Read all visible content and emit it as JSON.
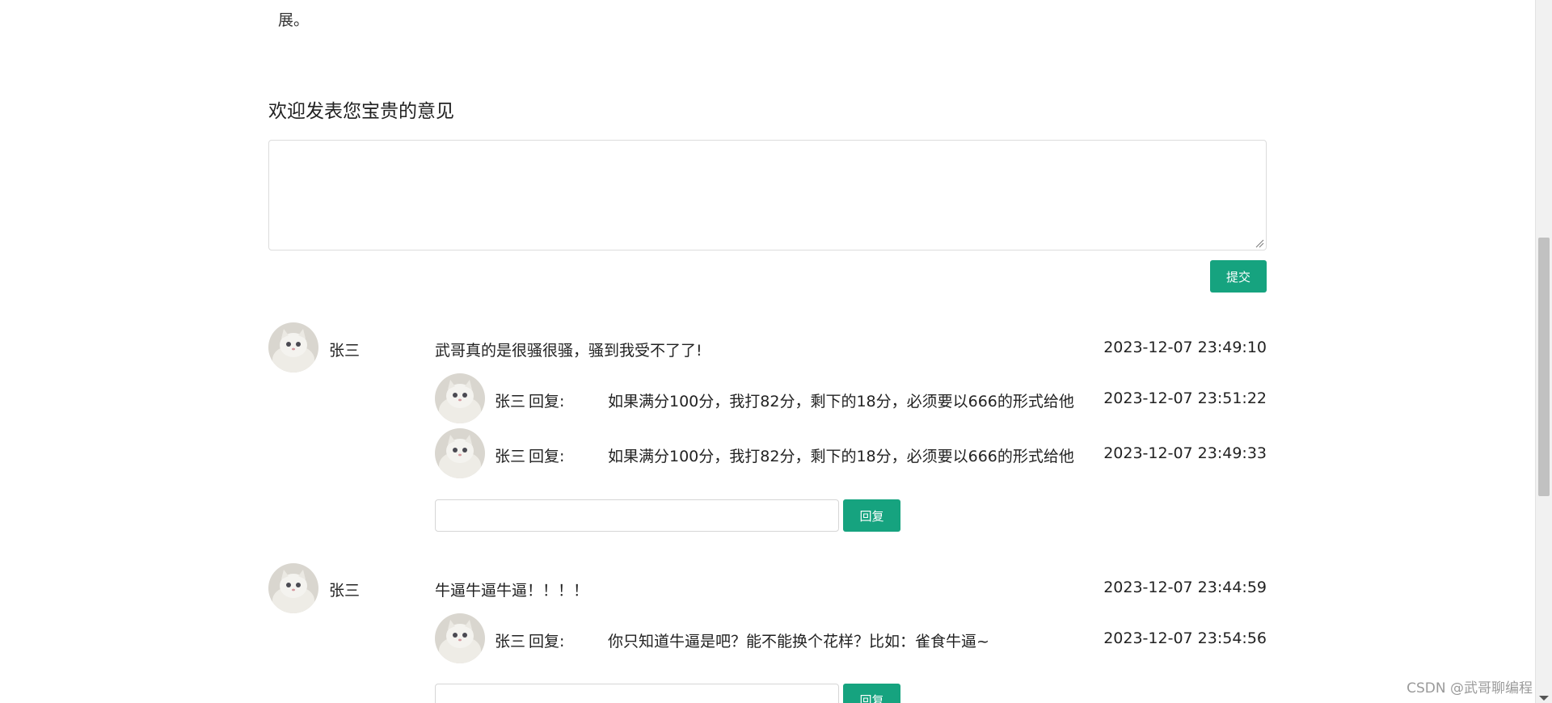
{
  "page": {
    "trailing_text": "展。",
    "section_title": "欢迎发表您宝贵的意见",
    "submit_label": "提交",
    "reply_button_label": "回复",
    "watermark": "CSDN @武哥聊编程"
  },
  "comments": [
    {
      "user": "张三",
      "content": "武哥真的是很骚很骚，骚到我受不了了!",
      "time": "2023-12-07 23:49:10",
      "replies": [
        {
          "user": "张三",
          "reply_label": "回复:",
          "content": "如果满分100分，我打82分，剩下的18分，必须要以666的形式给他",
          "time": "2023-12-07 23:51:22"
        },
        {
          "user": "张三",
          "reply_label": "回复:",
          "content": "如果满分100分，我打82分，剩下的18分，必须要以666的形式给他",
          "time": "2023-12-07 23:49:33"
        }
      ]
    },
    {
      "user": "张三",
      "content": "牛逼牛逼牛逼！！！！",
      "time": "2023-12-07 23:44:59",
      "replies": [
        {
          "user": "张三",
          "reply_label": "回复:",
          "content": "你只知道牛逼是吧？能不能换个花样？比如：雀食牛逼~",
          "time": "2023-12-07 23:54:56"
        }
      ]
    }
  ],
  "colors": {
    "accent": "#16a37f",
    "text": "#222222",
    "border": "#dcdcdc",
    "watermark": "#9a9a9a"
  },
  "icons": {
    "avatar": "cat-avatar",
    "textarea_grip": "resize-grip-icon",
    "scroll_down": "scroll-down-arrow"
  }
}
